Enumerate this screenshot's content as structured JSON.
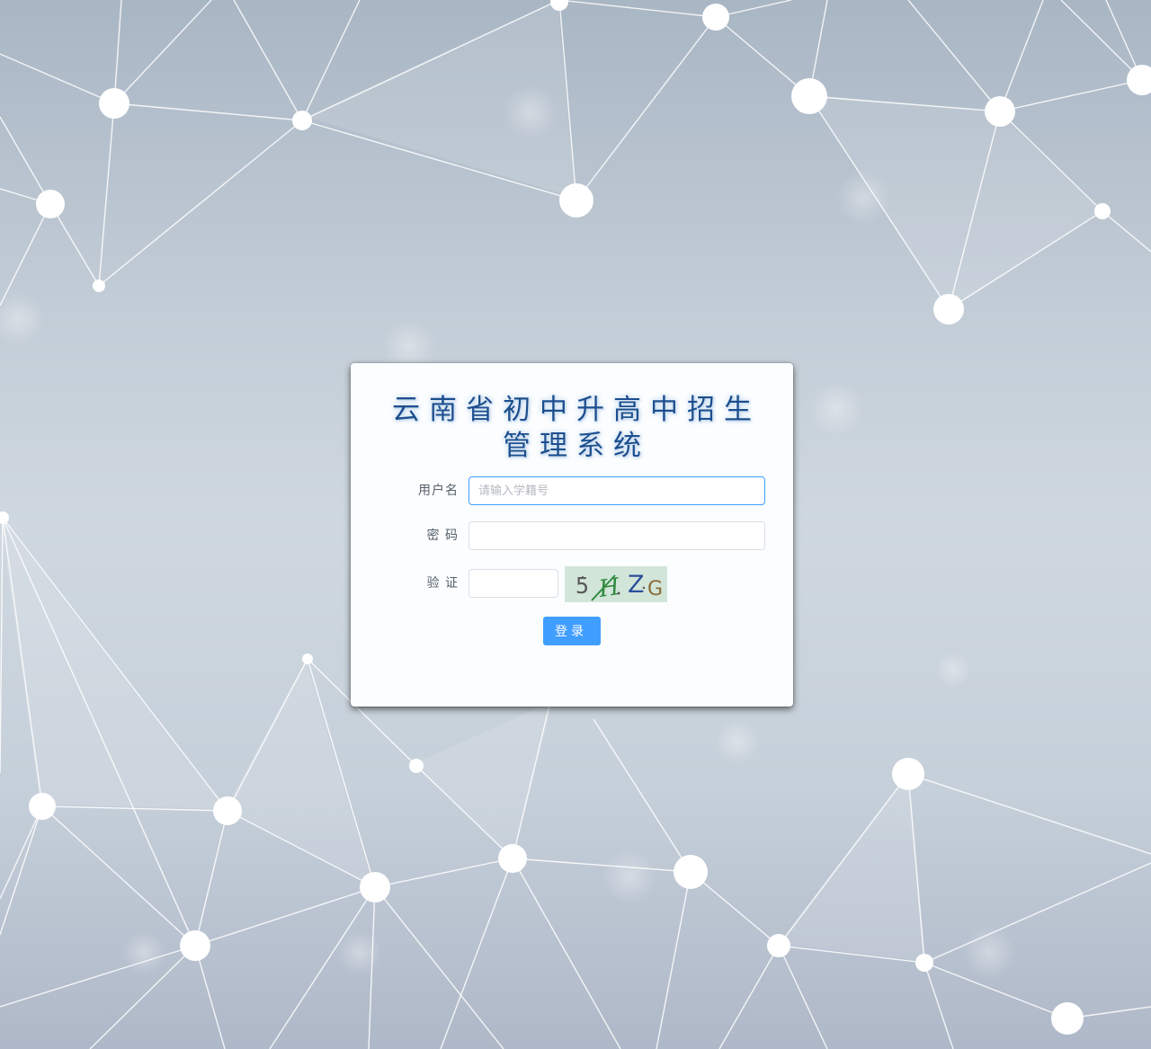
{
  "login": {
    "title_line1": "云南省初中升高中招生",
    "title_line2": "管理系统",
    "username_label": "用户名",
    "username_placeholder": "请输入学籍号",
    "username_value": "",
    "password_label": "密 码",
    "password_value": "",
    "captcha_label": "验 证",
    "captcha_value": "",
    "captcha_text": "5HZG",
    "submit_label": "登录"
  },
  "colors": {
    "accent": "#409eff",
    "title": "#1d4f8f"
  }
}
